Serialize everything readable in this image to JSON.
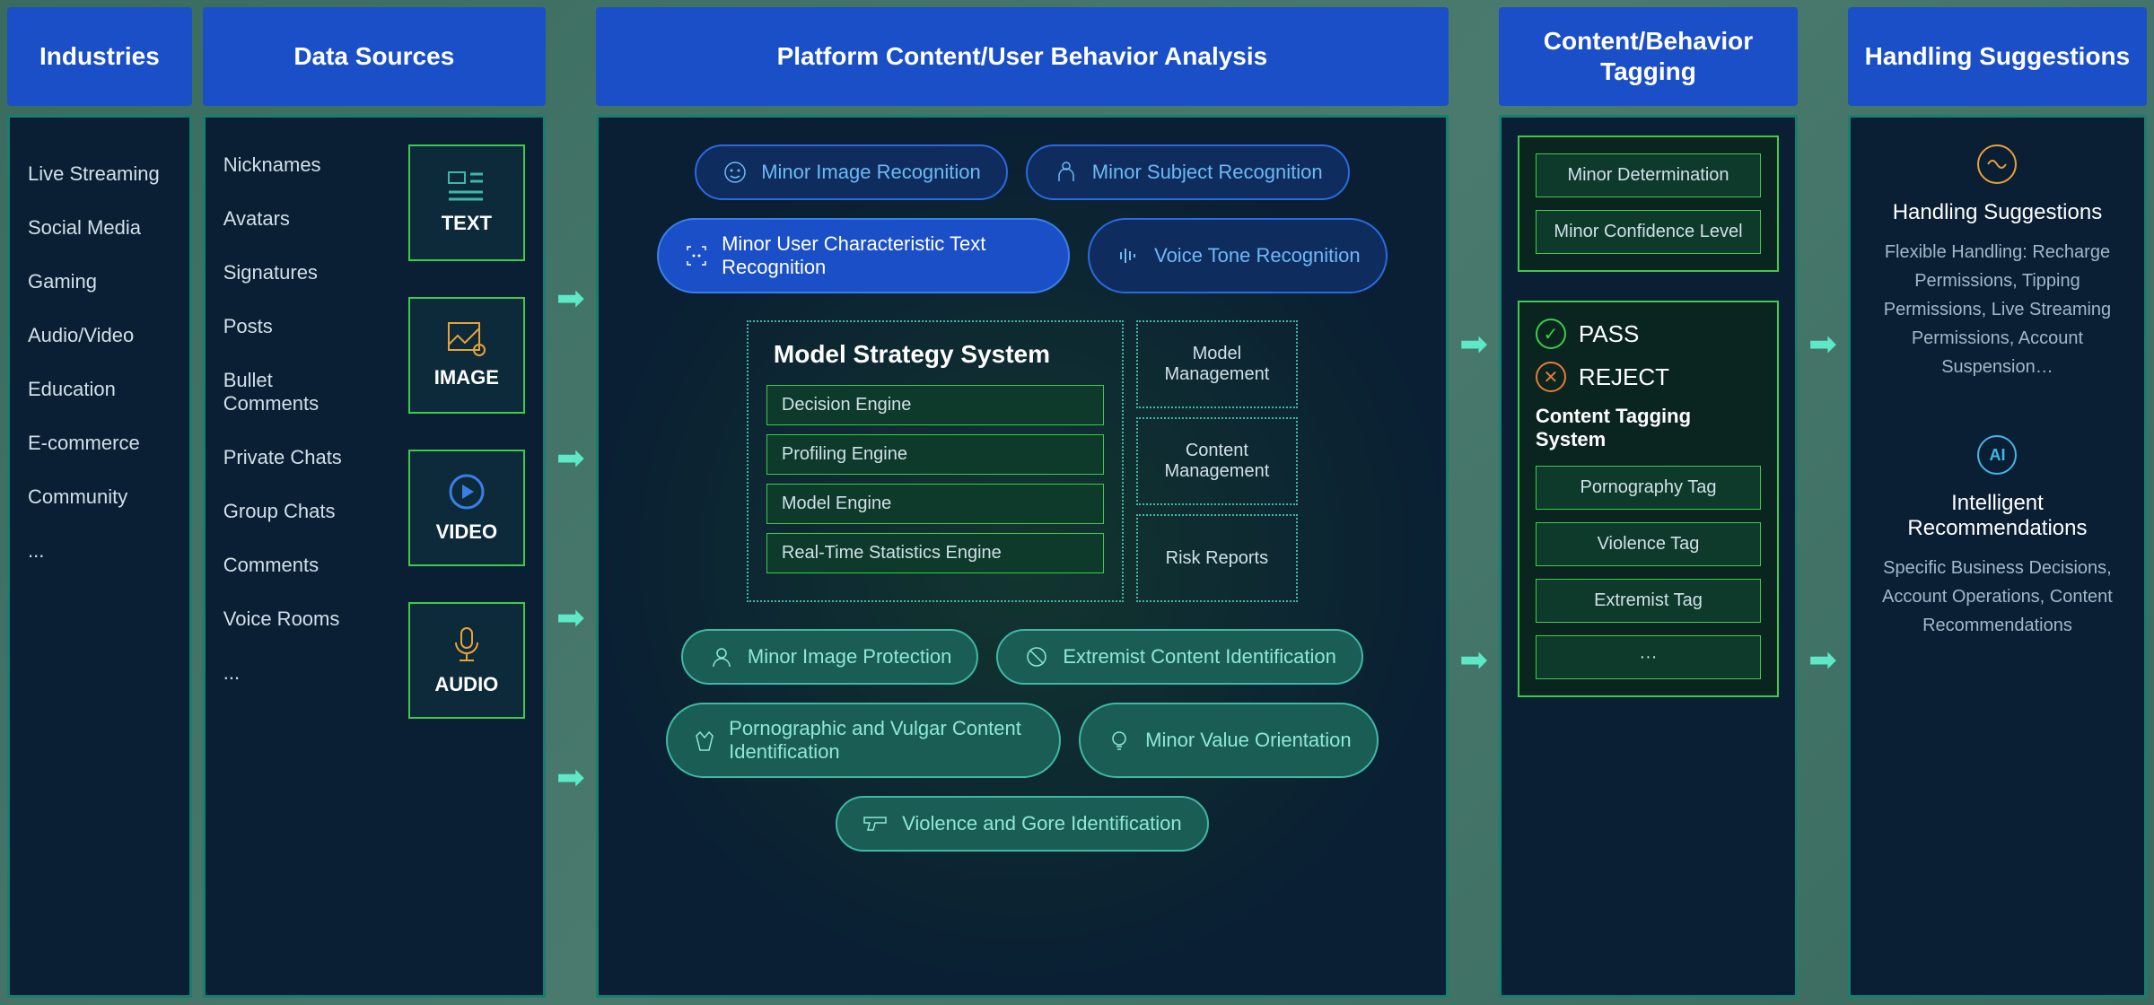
{
  "columns": {
    "industries": {
      "header": "Industries",
      "items": [
        "Live Streaming",
        "Social Media",
        "Gaming",
        "Audio/Video",
        "Education",
        "E-commerce",
        "Community",
        "..."
      ]
    },
    "sources": {
      "header": "Data Sources",
      "labels": [
        "Nicknames",
        "Avatars",
        "Signatures",
        "Posts",
        "Bullet Comments",
        "Private Chats",
        "Group Chats",
        "Comments",
        "Voice Rooms",
        "..."
      ],
      "boxes": [
        {
          "name": "text",
          "label": "TEXT",
          "color": "#3eb8a5"
        },
        {
          "name": "image",
          "label": "IMAGE",
          "color": "#e8a23a"
        },
        {
          "name": "video",
          "label": "VIDEO",
          "color": "#3a7fe8"
        },
        {
          "name": "audio",
          "label": "AUDIO",
          "color": "#e8a23a"
        }
      ]
    },
    "analysis": {
      "header": "Platform Content/User Behavior Analysis",
      "top_pills": [
        {
          "label": "Minor Image Recognition",
          "style": "blue"
        },
        {
          "label": "Minor Subject Recognition",
          "style": "blue"
        },
        {
          "label": "Minor User Characteristic Text Recognition",
          "style": "blue-filled"
        },
        {
          "label": "Voice Tone Recognition",
          "style": "blue"
        }
      ],
      "strategy": {
        "title": "Model Strategy System",
        "engines": [
          "Decision Engine",
          "Profiling Engine",
          "Model Engine",
          "Real-Time Statistics Engine"
        ],
        "mgmt": [
          "Model Management",
          "Content Management",
          "Risk Reports"
        ]
      },
      "bottom_pills": [
        {
          "label": "Minor Image Protection"
        },
        {
          "label": "Extremist Content Identification"
        },
        {
          "label": "Pornographic and Vulgar Content Identification"
        },
        {
          "label": "Minor Value Orientation"
        },
        {
          "label": "Violence and Gore Identification"
        }
      ]
    },
    "tagging": {
      "header": "Content/Behavior Tagging",
      "minor_tags": [
        "Minor Determination",
        "Minor Confidence Level"
      ],
      "status": {
        "pass": "PASS",
        "reject": "REJECT"
      },
      "subtitle": "Content Tagging System",
      "content_tags": [
        "Pornography Tag",
        "Violence Tag",
        "Extremist Tag",
        "···"
      ]
    },
    "handling": {
      "header": "Handling Suggestions",
      "sections": [
        {
          "icon": "wave",
          "color": "orange",
          "title": "Handling Suggestions",
          "desc": "Flexible Handling: Recharge Permissions, Tipping Permissions, Live Streaming Permissions, Account Suspension…"
        },
        {
          "icon": "ai",
          "color": "cyan",
          "title": "Intelligent Recommendations",
          "desc": "Specific Business Decisions, Account Operations, Content Recommendations"
        }
      ]
    }
  }
}
